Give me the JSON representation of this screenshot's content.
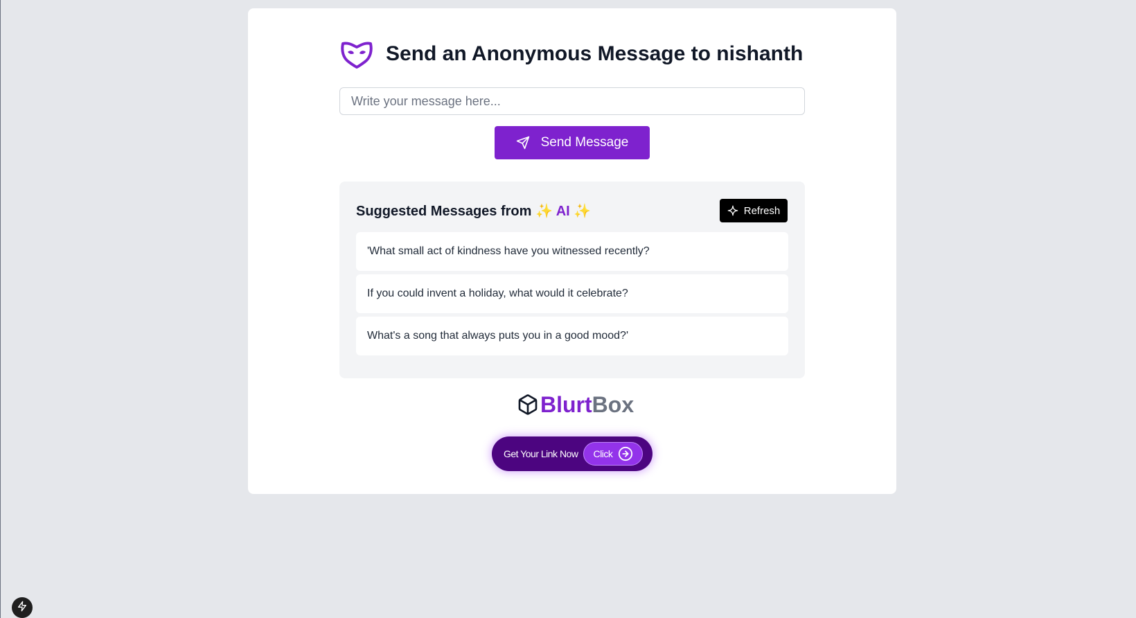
{
  "header": {
    "title": "Send an Anonymous Message to nishanth",
    "icon": "mask-icon",
    "accent_color": "#7e22ce"
  },
  "composer": {
    "placeholder": "Write your message here...",
    "value": "",
    "send_label": "Send Message",
    "send_icon": "send-icon",
    "button_color": "#7e22ce"
  },
  "suggestions": {
    "title_prefix": "Suggested Messages from",
    "sparkle_left": "✨",
    "ai_label": "AI",
    "sparkle_right": "✨",
    "refresh_label": "Refresh",
    "refresh_icon": "sparkle-icon",
    "items": [
      "'What small act of kindness have you witnessed recently?",
      "If you could invent a holiday, what would it celebrate?",
      "What's a song that always puts you in a good mood?'"
    ]
  },
  "brand": {
    "name_part1": "Blurt",
    "name_part2": "Box",
    "icon": "cube-icon",
    "color_part1": "#7e22ce",
    "color_part2": "#6b7280"
  },
  "cta": {
    "label": "Get Your Link Now",
    "click_label": "Click",
    "icon": "arrow-right-circle-icon"
  },
  "dev_indicator": {
    "icon": "lightning-icon"
  }
}
